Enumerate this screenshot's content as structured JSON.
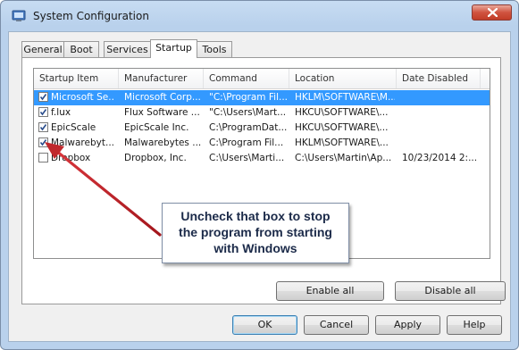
{
  "window": {
    "title": "System Configuration",
    "icon": "system-config-icon",
    "close_icon": "close-icon"
  },
  "tabs": [
    {
      "label": "General"
    },
    {
      "label": "Boot"
    },
    {
      "label": "Services"
    },
    {
      "label": "Startup",
      "active": true
    },
    {
      "label": "Tools"
    }
  ],
  "startup_list": {
    "columns": [
      "Startup Item",
      "Manufacturer",
      "Command",
      "Location",
      "Date Disabled"
    ],
    "rows": [
      {
        "checked": true,
        "selected": true,
        "item": "Microsoft Se...",
        "manufacturer": "Microsoft Corp...",
        "command": "\"C:\\Program Fil...",
        "location": "HKLM\\SOFTWARE\\M...",
        "date": ""
      },
      {
        "checked": true,
        "selected": false,
        "item": "f.lux",
        "manufacturer": "Flux Software ...",
        "command": "\"C:\\Users\\Mart...",
        "location": "HKCU\\SOFTWARE\\...",
        "date": ""
      },
      {
        "checked": true,
        "selected": false,
        "item": "EpicScale",
        "manufacturer": "EpicScale Inc.",
        "command": "C:\\ProgramDat...",
        "location": "HKCU\\SOFTWARE\\...",
        "date": ""
      },
      {
        "checked": true,
        "selected": false,
        "item": "Malwarebyt...",
        "manufacturer": "Malwarebytes ...",
        "command": "C:\\Program Fil...",
        "location": "HKLM\\SOFTWARE\\...",
        "date": ""
      },
      {
        "checked": false,
        "selected": false,
        "item": "Dropbox",
        "manufacturer": "Dropbox, Inc.",
        "command": "C:\\Users\\Marti...",
        "location": "C:\\Users\\Martin\\Ap...",
        "date": "10/23/2014 2:..."
      }
    ]
  },
  "annotation": {
    "lines": [
      "Uncheck that box to stop",
      "the program from starting",
      "with Windows"
    ],
    "arrow_color": "#c0282d"
  },
  "panel_buttons": {
    "enable_all": "Enable all",
    "disable_all": "Disable all"
  },
  "dialog_buttons": {
    "ok": "OK",
    "cancel": "Cancel",
    "apply": "Apply",
    "help": "Help"
  },
  "colors": {
    "selection": "#3399ff",
    "titlebar": "#b9d1ec",
    "close_button": "#c94a35"
  }
}
